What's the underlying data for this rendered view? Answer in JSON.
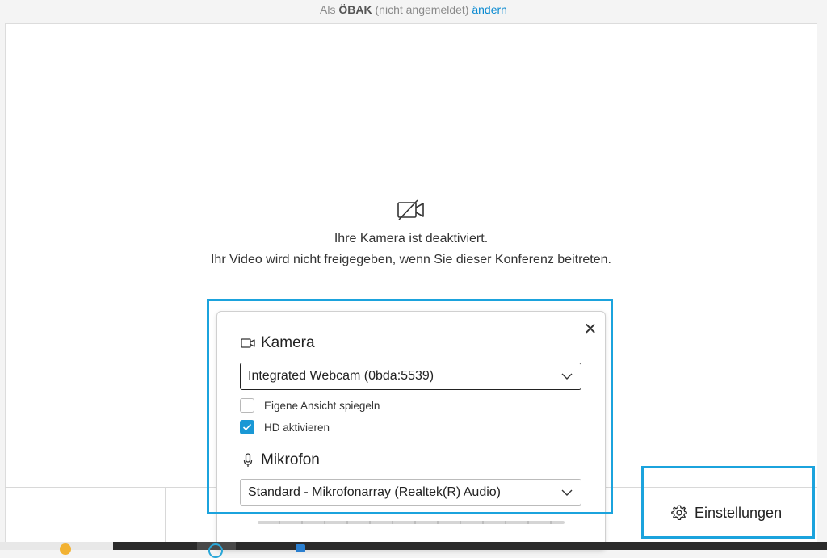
{
  "topbar": {
    "prefix": "Als",
    "name": "ÖBAK",
    "status": "(nicht angemeldet)",
    "change_link": "ändern"
  },
  "preview": {
    "icon": "camera-off-icon",
    "message_line1": "Ihre Kamera ist deaktiviert.",
    "message_line2": "Ihr Video wird nicht freigegeben, wenn Sie dieser Konferenz beitreten."
  },
  "panel": {
    "close_icon": "close-icon",
    "camera": {
      "icon": "video-camera-icon",
      "label": "Kamera",
      "selected": "Integrated Webcam (0bda:5539)",
      "options": [
        {
          "label": "Eigene Ansicht spiegeln",
          "checked": false
        },
        {
          "label": "HD aktivieren",
          "checked": true
        }
      ]
    },
    "microphone": {
      "icon": "microphone-icon",
      "label": "Mikrofon",
      "selected": "Standard - Mikrofonarray (Realtek(R) Audio)"
    }
  },
  "settings_button": {
    "icon": "gear-icon",
    "label": "Einstellungen"
  },
  "colors": {
    "accent": "#1a98d5",
    "highlight": "#1ba3dd",
    "link": "#0a8ad1"
  }
}
